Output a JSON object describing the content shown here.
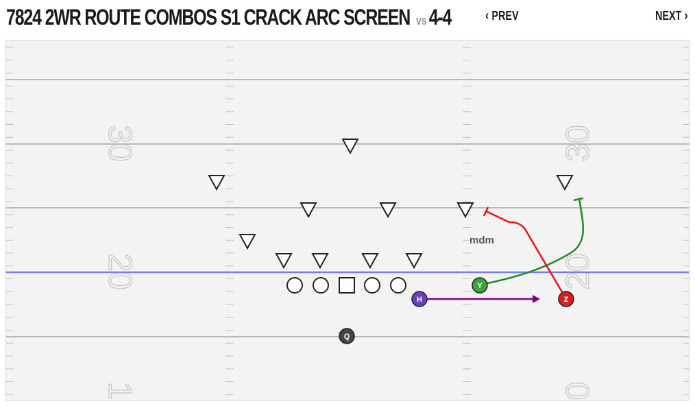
{
  "header": {
    "title_main": "7824 2WR ROUTE COMBOS S1 CRACK ARC SCREEN",
    "vs_label": "vs",
    "opponent": "4-4",
    "prev_label": "PREV",
    "next_label": "NEXT"
  },
  "field": {
    "yard_numbers_left": [
      "30",
      "20",
      "1"
    ],
    "yard_numbers_right": [
      "30",
      "20",
      "0"
    ],
    "line_of_scrimmage_color": "#7b7bea"
  },
  "offense": {
    "linemen_count": 5,
    "center_marker": "square",
    "skill_players": [
      {
        "label": "H",
        "color": "#6a3fbf"
      },
      {
        "label": "Y",
        "color": "#3aa63a"
      },
      {
        "label": "Z",
        "color": "#d42020"
      },
      {
        "label": "Q",
        "color": "#444444"
      }
    ]
  },
  "defense": {
    "player_count": 11,
    "marker": "inverted-triangle"
  },
  "routes": [
    {
      "player": "H",
      "color": "#800080",
      "end": "arrow"
    },
    {
      "player": "Y",
      "color": "#1e8a1e",
      "end": "block-t"
    },
    {
      "player": "Z",
      "color": "#ee1111",
      "end": "block-t"
    }
  ],
  "annotations": {
    "assignment_note": "mdm"
  }
}
